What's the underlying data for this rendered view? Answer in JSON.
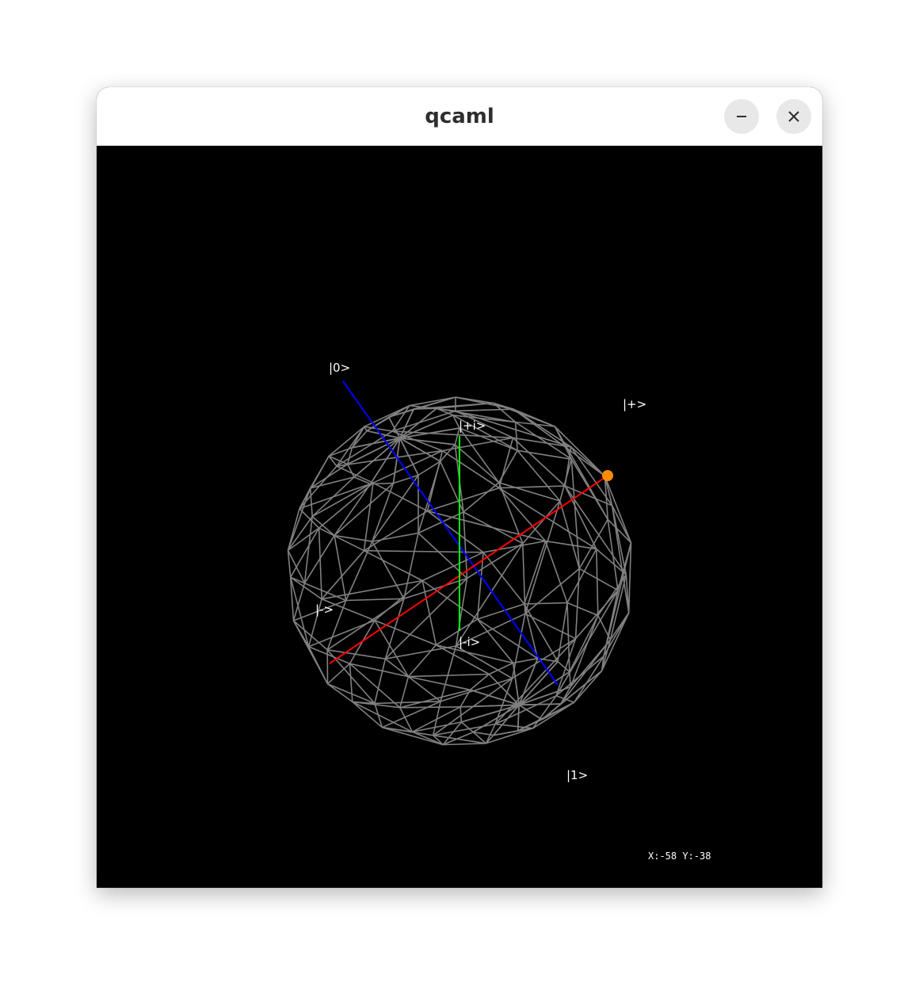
{
  "window": {
    "title": "qcaml",
    "minimize_icon": "minimize-icon",
    "close_icon": "close-icon"
  },
  "scene": {
    "background": "#000000",
    "wireframe_color": "#808080",
    "axes": {
      "z": {
        "color": "#0000ff",
        "top_label": "|0>",
        "bottom_label": "|1>"
      },
      "x": {
        "color": "#ff0000",
        "positive_label": "|+>",
        "negative_label": "|->"
      },
      "y": {
        "color": "#00ff00",
        "positive_label": "|+i>",
        "negative_label": "|-i>"
      }
    },
    "state_marker": {
      "color": "#ff8c00",
      "at": "|+>"
    },
    "coordinates": "X:-58 Y:-38"
  }
}
